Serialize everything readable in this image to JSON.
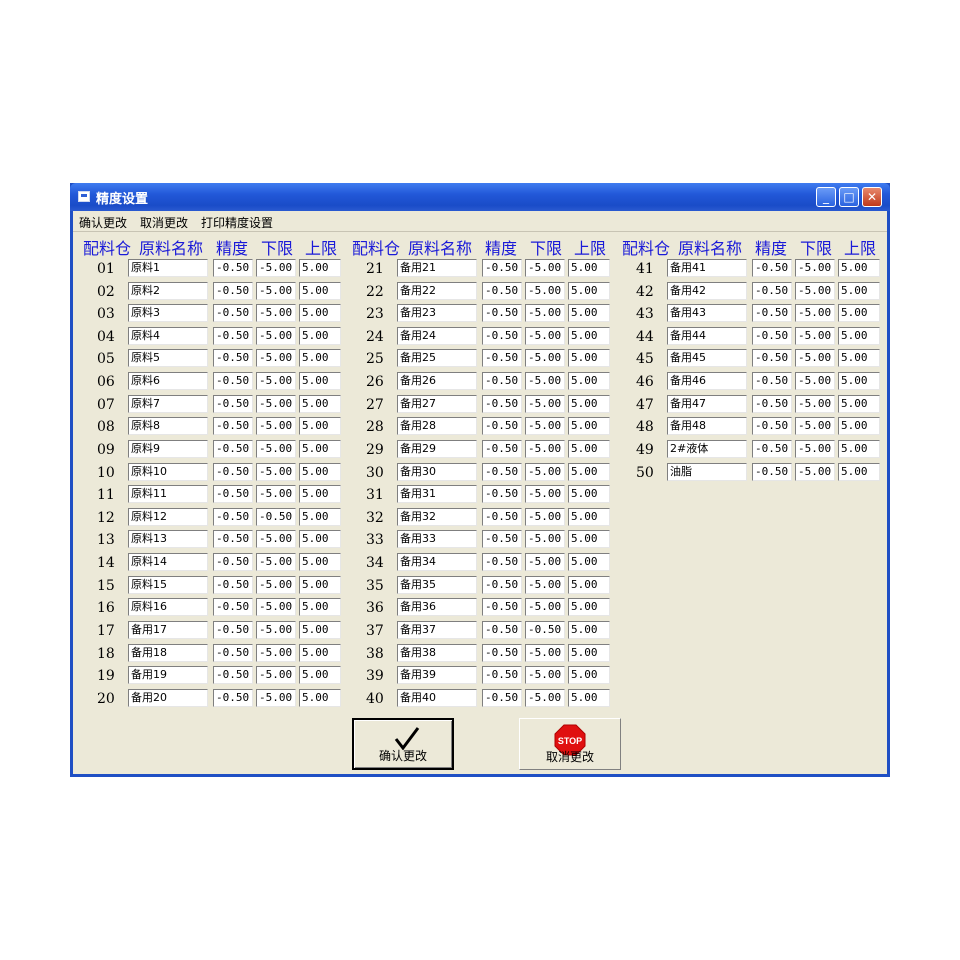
{
  "window": {
    "title": "精度设置",
    "minimize": "_",
    "maximize": "□",
    "close": "✕"
  },
  "menu": [
    "确认更改",
    "取消更改",
    "打印精度设置"
  ],
  "headers": [
    "配料仓",
    "原料名称",
    "精度",
    "下限",
    "上限"
  ],
  "rows": [
    [
      "01",
      "原料1",
      "-0.50",
      "-5.00",
      "5.00"
    ],
    [
      "02",
      "原料2",
      "-0.50",
      "-5.00",
      "5.00"
    ],
    [
      "03",
      "原料3",
      "-0.50",
      "-5.00",
      "5.00"
    ],
    [
      "04",
      "原料4",
      "-0.50",
      "-5.00",
      "5.00"
    ],
    [
      "05",
      "原料5",
      "-0.50",
      "-5.00",
      "5.00"
    ],
    [
      "06",
      "原料6",
      "-0.50",
      "-5.00",
      "5.00"
    ],
    [
      "07",
      "原料7",
      "-0.50",
      "-5.00",
      "5.00"
    ],
    [
      "08",
      "原料8",
      "-0.50",
      "-5.00",
      "5.00"
    ],
    [
      "09",
      "原料9",
      "-0.50",
      "-5.00",
      "5.00"
    ],
    [
      "10",
      "原料10",
      "-0.50",
      "-5.00",
      "5.00"
    ],
    [
      "11",
      "原料11",
      "-0.50",
      "-5.00",
      "5.00"
    ],
    [
      "12",
      "原料12",
      "-0.50",
      "-0.50",
      "5.00"
    ],
    [
      "13",
      "原料13",
      "-0.50",
      "-5.00",
      "5.00"
    ],
    [
      "14",
      "原料14",
      "-0.50",
      "-5.00",
      "5.00"
    ],
    [
      "15",
      "原料15",
      "-0.50",
      "-5.00",
      "5.00"
    ],
    [
      "16",
      "原料16",
      "-0.50",
      "-5.00",
      "5.00"
    ],
    [
      "17",
      "备用17",
      "-0.50",
      "-5.00",
      "5.00"
    ],
    [
      "18",
      "备用18",
      "-0.50",
      "-5.00",
      "5.00"
    ],
    [
      "19",
      "备用19",
      "-0.50",
      "-5.00",
      "5.00"
    ],
    [
      "20",
      "备用20",
      "-0.50",
      "-5.00",
      "5.00"
    ],
    [
      "21",
      "备用21",
      "-0.50",
      "-5.00",
      "5.00"
    ],
    [
      "22",
      "备用22",
      "-0.50",
      "-5.00",
      "5.00"
    ],
    [
      "23",
      "备用23",
      "-0.50",
      "-5.00",
      "5.00"
    ],
    [
      "24",
      "备用24",
      "-0.50",
      "-5.00",
      "5.00"
    ],
    [
      "25",
      "备用25",
      "-0.50",
      "-5.00",
      "5.00"
    ],
    [
      "26",
      "备用26",
      "-0.50",
      "-5.00",
      "5.00"
    ],
    [
      "27",
      "备用27",
      "-0.50",
      "-5.00",
      "5.00"
    ],
    [
      "28",
      "备用28",
      "-0.50",
      "-5.00",
      "5.00"
    ],
    [
      "29",
      "备用29",
      "-0.50",
      "-5.00",
      "5.00"
    ],
    [
      "30",
      "备用30",
      "-0.50",
      "-5.00",
      "5.00"
    ],
    [
      "31",
      "备用31",
      "-0.50",
      "-5.00",
      "5.00"
    ],
    [
      "32",
      "备用32",
      "-0.50",
      "-5.00",
      "5.00"
    ],
    [
      "33",
      "备用33",
      "-0.50",
      "-5.00",
      "5.00"
    ],
    [
      "34",
      "备用34",
      "-0.50",
      "-5.00",
      "5.00"
    ],
    [
      "35",
      "备用35",
      "-0.50",
      "-5.00",
      "5.00"
    ],
    [
      "36",
      "备用36",
      "-0.50",
      "-5.00",
      "5.00"
    ],
    [
      "37",
      "备用37",
      "-0.50",
      "-0.50",
      "5.00"
    ],
    [
      "38",
      "备用38",
      "-0.50",
      "-5.00",
      "5.00"
    ],
    [
      "39",
      "备用39",
      "-0.50",
      "-5.00",
      "5.00"
    ],
    [
      "40",
      "备用40",
      "-0.50",
      "-5.00",
      "5.00"
    ],
    [
      "41",
      "备用41",
      "-0.50",
      "-5.00",
      "5.00"
    ],
    [
      "42",
      "备用42",
      "-0.50",
      "-5.00",
      "5.00"
    ],
    [
      "43",
      "备用43",
      "-0.50",
      "-5.00",
      "5.00"
    ],
    [
      "44",
      "备用44",
      "-0.50",
      "-5.00",
      "5.00"
    ],
    [
      "45",
      "备用45",
      "-0.50",
      "-5.00",
      "5.00"
    ],
    [
      "46",
      "备用46",
      "-0.50",
      "-5.00",
      "5.00"
    ],
    [
      "47",
      "备用47",
      "-0.50",
      "-5.00",
      "5.00"
    ],
    [
      "48",
      "备用48",
      "-0.50",
      "-5.00",
      "5.00"
    ],
    [
      "49",
      "2#液体",
      "-0.50",
      "-5.00",
      "5.00"
    ],
    [
      "50",
      "油脂",
      "-0.50",
      "-5.00",
      "5.00"
    ]
  ],
  "buttons": {
    "confirm": "确认更改",
    "cancel": "取消更改",
    "stop_sign": "STOP"
  },
  "icons": {
    "confirm": "checkmark-icon",
    "cancel": "stop-sign-icon"
  }
}
